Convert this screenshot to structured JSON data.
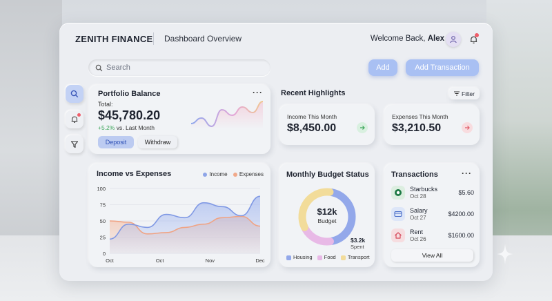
{
  "header": {
    "brand": "ZENITH FINANCE",
    "subtitle": "Dashboard Overview",
    "welcome_prefix": "Welcome Back,",
    "user_name": "Alex"
  },
  "toolbar": {
    "search_placeholder": "Search",
    "add_label": "Add",
    "add_transaction_label": "Add Transaction"
  },
  "sidebar": {
    "icons": [
      "search-icon",
      "bell-icon",
      "filter-icon"
    ]
  },
  "portfolio": {
    "title": "Portfolio Balance",
    "more": "···",
    "total_label": "Total:",
    "total_value": "$45,780.20",
    "change": "+5.2%",
    "change_suffix": "vs. Last Month",
    "deposit_label": "Deposit",
    "withdraw_label": "Withdraw",
    "sparkline": [
      3,
      4,
      2.5,
      5.5,
      4.5,
      6,
      5,
      7
    ]
  },
  "highlights": {
    "title": "Recent Highlights",
    "filter_label": "Filter",
    "income_label": "Income This Month",
    "income_value": "$8,450.00",
    "expenses_label": "Expenses This Month",
    "expenses_value": "$3,210.50"
  },
  "income_expenses": {
    "title": "Income vs Expenses",
    "legend_income": "Income",
    "legend_expenses": "Expenses",
    "y_ticks": [
      "100",
      "75",
      "50",
      "25",
      "0"
    ],
    "x_ticks": [
      "Oct",
      "Oct",
      "Nov",
      "Dec"
    ]
  },
  "chart_data": {
    "type": "area",
    "title": "Income vs Expenses",
    "ylim": [
      0,
      100
    ],
    "x": [
      "Oct",
      "Oct",
      "Nov",
      "Dec"
    ],
    "series": [
      {
        "name": "Income",
        "color": "#8ea5e8",
        "values": [
          22,
          45,
          40,
          60,
          55,
          78,
          72,
          58,
          88
        ]
      },
      {
        "name": "Expenses",
        "color": "#f1a98a",
        "values": [
          50,
          48,
          30,
          32,
          40,
          45,
          55,
          57,
          42
        ]
      }
    ]
  },
  "budget": {
    "title": "Monthly Budget Status",
    "center_value": "$12k",
    "center_label": "Budget",
    "spent_value": "$3.2k",
    "spent_label": "Spent",
    "legend": [
      "Housing",
      "Food",
      "Transport"
    ],
    "colors": [
      "#93a8ea",
      "#e8b9e6",
      "#f2dc9a"
    ],
    "shares": [
      0.45,
      0.2,
      0.35
    ]
  },
  "transactions": {
    "title": "Transactions",
    "more": "···",
    "items": [
      {
        "name": "Starbucks",
        "date": "Oct 28",
        "amount": "$5.60"
      },
      {
        "name": "Salary",
        "date": "Oct 27",
        "amount": "$4200.00"
      },
      {
        "name": "Rent",
        "date": "Oct 26",
        "amount": "$1600.00"
      }
    ],
    "view_all": "View All"
  }
}
